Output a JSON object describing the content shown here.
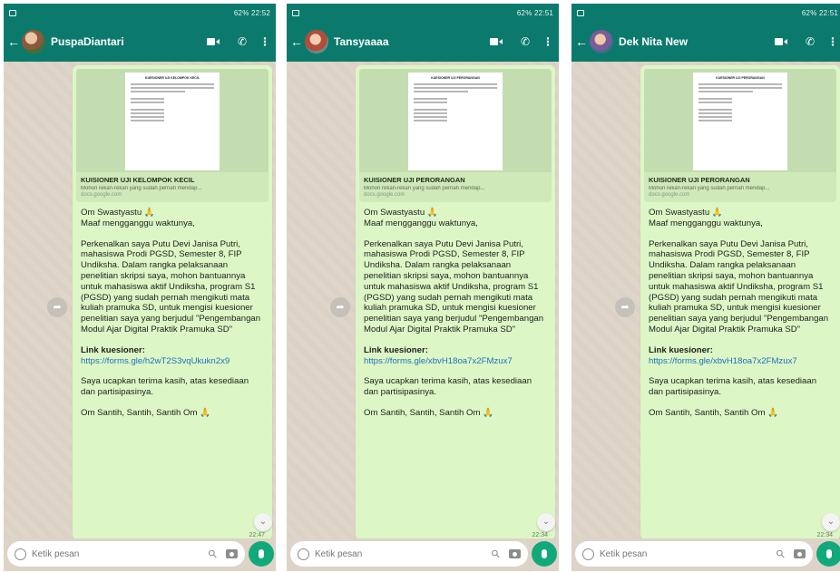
{
  "screens": [
    {
      "status_time": "22:52",
      "status_battery": "62%",
      "contact_name": "PuspaDiantari",
      "link_preview": {
        "title": "KUISIONER UJI KELOMPOK KECIL",
        "description": "Mohon rekan-rekan yang sudah pernah mendap...",
        "url": "docs.google.com",
        "document_heading": "KUESIONER UJI KELOMPOK KECIL"
      },
      "message": {
        "greeting": "Om Swastyastu 🙏",
        "line2": "Maaf mengganggu waktunya,",
        "body": "Perkenalkan saya Putu Devi Janisa Putri, mahasiswa Prodi PGSD, Semester 8, FIP Undiksha. Dalam rangka pelaksanaan penelitian skripsi saya, mohon bantuannya untuk mahasiswa aktif Undiksha, program S1 (PGSD) yang sudah pernah mengikuti mata kuliah pramuka SD, untuk mengisi kuesioner penelitian saya yang berjudul \"Pengembangan Modul Ajar Digital Praktik Pramuka SD\"",
        "link_label": "Link kuesioner:",
        "link_url": "https://forms.gle/h2wT2S3vqUkukn2x9",
        "thanks": "Saya ucapkan terima kasih, atas kesediaan dan partisipasinya.",
        "closing": "Om Santih, Santih, Santih Om 🙏",
        "time": "22:47"
      },
      "input_placeholder": "Ketik pesan"
    },
    {
      "status_time": "22:51",
      "status_battery": "62%",
      "contact_name": "Tansyaaaa",
      "link_preview": {
        "title": "KUISIONER UJI PERORANGAN",
        "description": "Mohon rekan-rekan yang sudah pernah mendap...",
        "url": "docs.google.com",
        "document_heading": "KUESIONER UJI PERORANGAN"
      },
      "message": {
        "greeting": "Om Swastyastu 🙏",
        "line2": "Maaf mengganggu waktunya,",
        "body": "Perkenalkan saya Putu Devi Janisa Putri, mahasiswa Prodi PGSD, Semester 8, FIP Undiksha. Dalam rangka pelaksanaan penelitian skripsi saya, mohon bantuannya untuk mahasiswa aktif Undiksha, program S1 (PGSD) yang sudah pernah mengikuti mata kuliah pramuka SD, untuk mengisi kuesioner penelitian saya yang berjudul \"Pengembangan Modul Ajar Digital Praktik Pramuka SD\"",
        "link_label": "Link kuesioner:",
        "link_url": "https://forms.gle/xbvH18oa7x2FMzux7",
        "thanks": "Saya ucapkan terima kasih, atas kesediaan dan partisipasinya.",
        "closing": "Om Santih, Santih, Santih Om 🙏",
        "time": "22:34"
      },
      "input_placeholder": "Ketik pesan"
    },
    {
      "status_time": "22:51",
      "status_battery": "62%",
      "contact_name": "Dek Nita New",
      "link_preview": {
        "title": "KUISIONER UJI PERORANGAN",
        "description": "Mohon rekan-rekan yang sudah pernah mendap...",
        "url": "docs.google.com",
        "document_heading": "KUESIONER UJI PERORANGAN"
      },
      "message": {
        "greeting": "Om Swastyastu 🙏",
        "line2": "Maaf mengganggu waktunya,",
        "body": "Perkenalkan saya Putu Devi Janisa Putri, mahasiswa Prodi PGSD, Semester 8, FIP Undiksha. Dalam rangka pelaksanaan penelitian skripsi saya, mohon bantuannya untuk mahasiswa aktif Undiksha, program S1 (PGSD) yang sudah pernah mengikuti mata kuliah pramuka SD, untuk mengisi kuesioner penelitian saya yang berjudul \"Pengembangan Modul Ajar Digital Praktik Pramuka SD\"",
        "link_label": "Link kuesioner:",
        "link_url": "https://forms.gle/xbvH18oa7x2FMzux7",
        "thanks": "Saya ucapkan terima kasih, atas kesediaan dan partisipasinya.",
        "closing": "Om Santih, Santih, Santih Om 🙏",
        "time": "22:34"
      },
      "input_placeholder": "Ketik pesan"
    }
  ],
  "icons": {
    "back": "arrow-left-icon",
    "video": "video-call-icon",
    "call": "phone-icon",
    "menu": "more-vertical-icon",
    "forward": "forward-icon",
    "scroll_down": "chevron-down-icon",
    "emoji": "emoji-icon",
    "attach": "paperclip-icon",
    "camera": "camera-icon",
    "mic": "mic-icon"
  },
  "colors": {
    "header": "#0b7a6c",
    "bubble": "#dcf7c5",
    "link": "#1f6fbf",
    "mic": "#12a97a"
  }
}
